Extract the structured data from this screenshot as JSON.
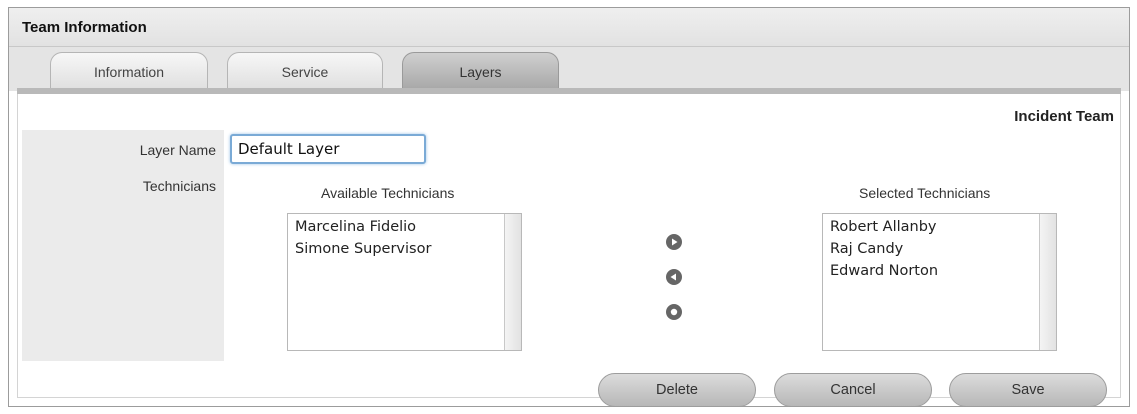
{
  "header": {
    "title": "Team Information"
  },
  "tabs": [
    {
      "label": "Information",
      "active": false
    },
    {
      "label": "Service",
      "active": false
    },
    {
      "label": "Layers",
      "active": true
    }
  ],
  "team_name": "Incident Team",
  "form": {
    "layer_name_label": "Layer Name",
    "layer_name_value": "Default Layer",
    "technicians_label": "Technicians"
  },
  "available": {
    "title": "Available Technicians",
    "items": [
      "Marcelina Fidelio",
      "Simone Supervisor"
    ]
  },
  "selected": {
    "title": "Selected Technicians",
    "items": [
      "Robert Allanby",
      "Raj Candy",
      "Edward Norton"
    ]
  },
  "transfer_icons": [
    "move-right-icon",
    "move-left-icon",
    "move-all-icon"
  ],
  "buttons": {
    "delete": "Delete",
    "cancel": "Cancel",
    "save": "Save"
  },
  "colors": {
    "input_focus": "#7aaad6",
    "active_tab": "#b0b0b0"
  }
}
